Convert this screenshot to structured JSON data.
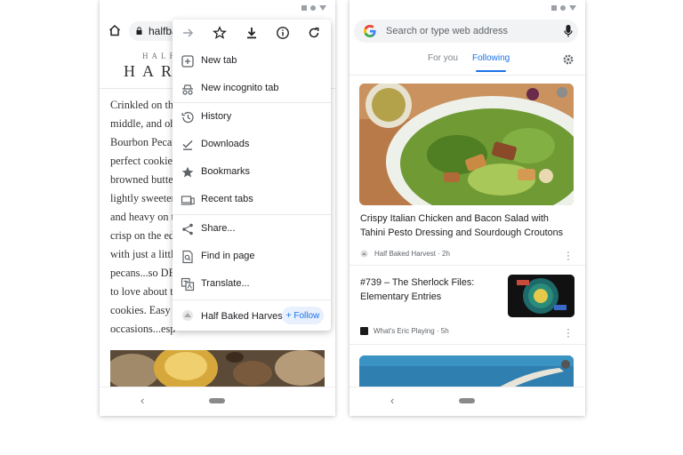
{
  "left_phone": {
    "url_partial": "halfba",
    "site_logo_top": "HALF",
    "site_logo_main": "HAR",
    "article_lines": [
      "Crinkled on th",
      "middle, and oh",
      "Bourbon Pecan",
      "perfect cookies",
      "browned butte",
      "lightly sweeten",
      "and heavy on t",
      "crisp on the ed",
      "with just a littl",
      "pecans...so DE",
      "to love about t",
      "cookies. Easy t",
      "occasions...esp"
    ]
  },
  "menu": {
    "top_icons": [
      "forward-icon",
      "bookmark-star-icon",
      "download-icon",
      "info-icon",
      "reload-icon"
    ],
    "items": [
      {
        "label": "New tab",
        "icon": "new-tab-icon"
      },
      {
        "label": "New incognito tab",
        "icon": "incognito-icon"
      },
      {
        "label": "History",
        "icon": "history-icon"
      },
      {
        "label": "Downloads",
        "icon": "downloads-check-icon"
      },
      {
        "label": "Bookmarks",
        "icon": "star-icon"
      },
      {
        "label": "Recent tabs",
        "icon": "recent-tabs-icon"
      },
      {
        "label": "Share...",
        "icon": "share-icon"
      },
      {
        "label": "Find in page",
        "icon": "find-in-page-icon"
      },
      {
        "label": "Translate...",
        "icon": "translate-icon"
      }
    ],
    "site_name": "Half Baked Harvest",
    "follow_label": "+ Follow"
  },
  "right_phone": {
    "search_placeholder": "Search or type web address",
    "tabs": [
      "For you",
      "Following"
    ],
    "active_tab": "Following",
    "cards": [
      {
        "title": "Crispy Italian Chicken and Bacon Salad with Tahini Pesto Dressing and Sourdough Croutons",
        "meta": "Half Baked Harvest · 2h"
      },
      {
        "title": "#739 – The Sherlock Files: Elementary Entries",
        "meta": "What's Eric Playing · 5h"
      }
    ]
  },
  "nav": {
    "back_glyph": "‹"
  },
  "colors": {
    "accent": "#1a73e8",
    "text": "#202124",
    "muted": "#5f6368"
  }
}
